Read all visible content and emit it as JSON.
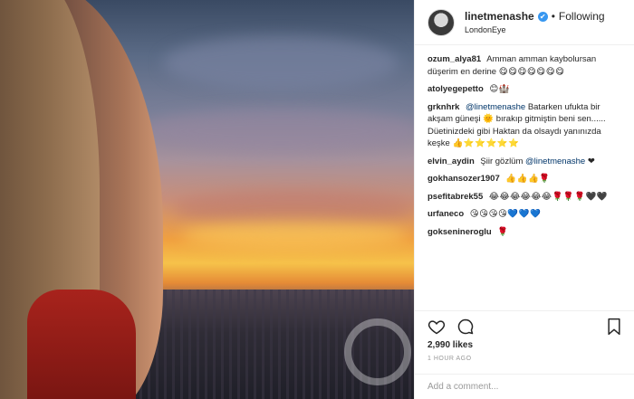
{
  "post": {
    "username": "linetmenashe",
    "verified_mark": "✔",
    "separator": "•",
    "follow_status": "Following",
    "location": "LondonEye"
  },
  "comments": [
    {
      "user": "ozum_alya81",
      "text": "Amman amman kaybolursan düşerim en derine",
      "emoji": "😋😋😋😋😋😋😋"
    },
    {
      "user": "atolyegepetto",
      "text": "",
      "emoji": "😊🏰"
    },
    {
      "user": "grknhrk",
      "mention": "@linetmenashe",
      "text": "Batarken ufukta bir akşam güneşi 🌞 bırakıp gitmiştin beni sen...... Düetinizdeki gibi Haktan da olsaydı yanınızda keşke",
      "emoji": "👍⭐⭐⭐⭐⭐"
    },
    {
      "user": "elvin_aydin",
      "text": "Şiir gözlüm",
      "mention": "@linetmenashe",
      "emoji": "❤"
    },
    {
      "user": "gokhansozer1907",
      "text": "",
      "emoji": "👍👍👍🌹"
    },
    {
      "user": "psefitabrek55",
      "text": "",
      "emoji": "😂😂😂😂😂😂🌹🌹🌹🖤🖤"
    },
    {
      "user": "urfaneco",
      "text": "",
      "emoji": "😘😘😘😘💙💙💙"
    },
    {
      "user": "goksenineroglu",
      "text": "",
      "emoji": "🌹"
    }
  ],
  "actions": {
    "like_icon": "heart-icon",
    "comment_icon": "comment-bubble-icon",
    "save_icon": "bookmark-icon",
    "likes": "2,990 likes",
    "time": "1 HOUR AGO",
    "add_comment_placeholder": "Add a comment..."
  },
  "colors": {
    "verified": "#3897f0",
    "mention": "#003569",
    "border": "#efefef"
  }
}
